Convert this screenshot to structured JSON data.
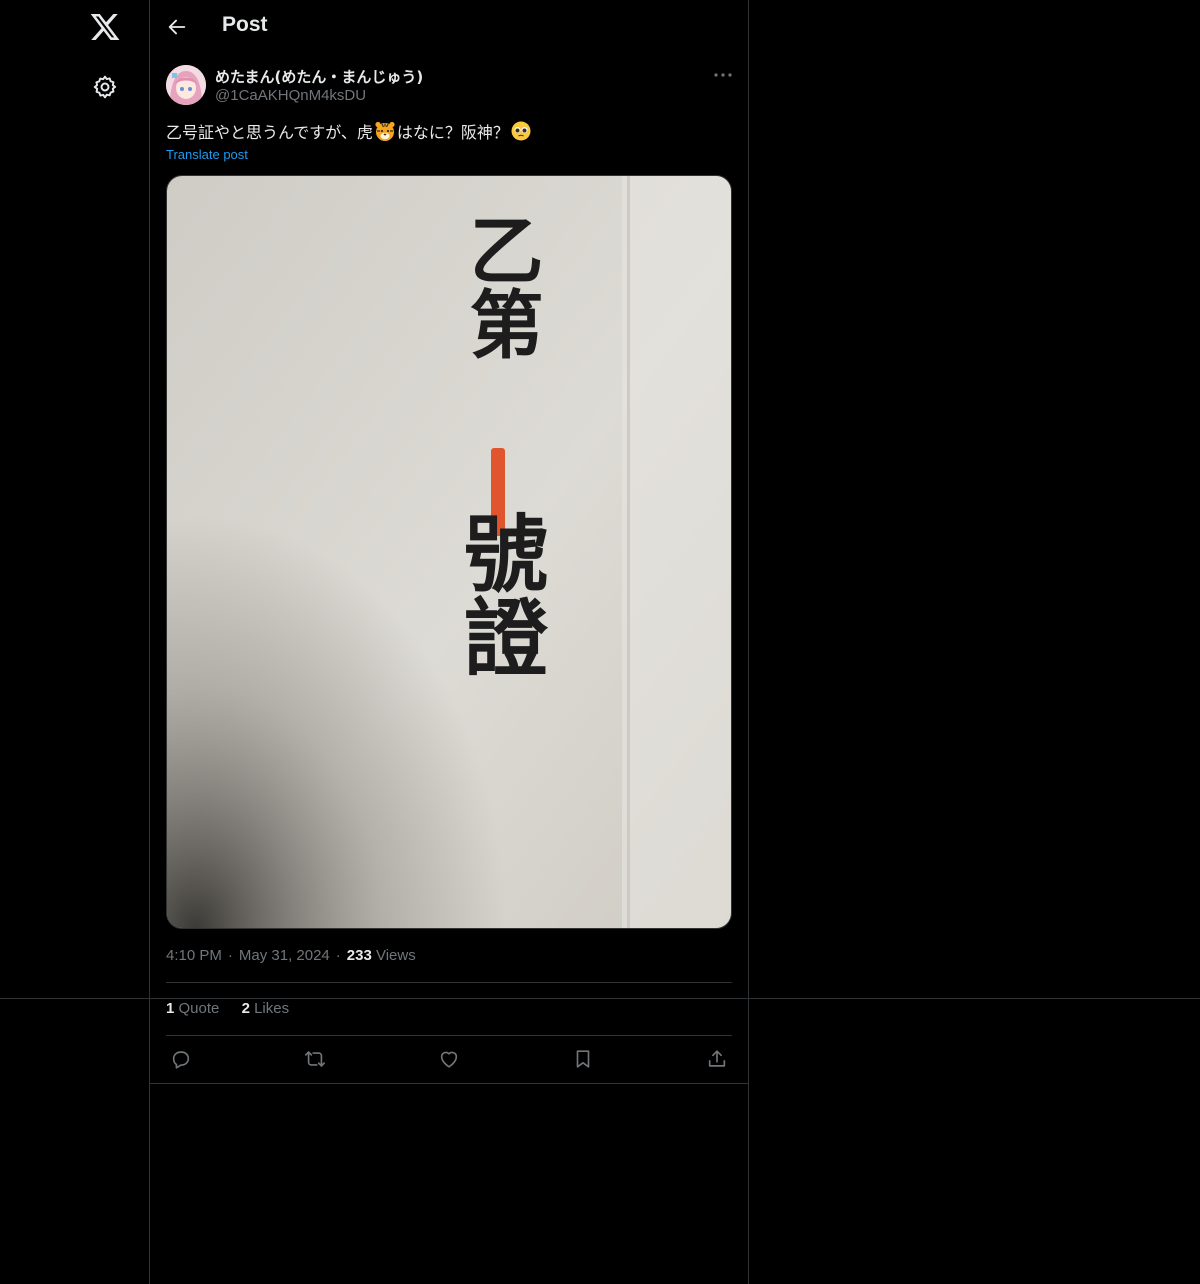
{
  "header": {
    "title": "Post"
  },
  "author": {
    "display_name": "めたまん(めたん・まんじゅう)",
    "handle": "@1CaAKHQnM4ksDU"
  },
  "post": {
    "text_before_tiger": "乙号証やと思うんですが、虎",
    "text_after_tiger": "はなに？阪神？",
    "emoji_1": "tiger-face-emoji",
    "emoji_2": "pleading-face-emoji",
    "translate_label": "Translate post",
    "image": {
      "text_top": "乙第",
      "text_bottom": "號證",
      "mark": "red-vertical-line",
      "paper_color": "#dcdad3",
      "ink_color": "#1d1d1d",
      "mark_color": "#e0552d"
    }
  },
  "meta": {
    "time": "4:10 PM",
    "date": "May 31, 2024",
    "views_count": "233",
    "views_label": "Views"
  },
  "stats": {
    "quotes_count": "1",
    "quotes_label": "Quote",
    "likes_count": "2",
    "likes_label": "Likes"
  },
  "actions": [
    "reply-icon",
    "repost-icon",
    "like-icon",
    "bookmark-icon",
    "share-icon"
  ],
  "colors": {
    "background": "#000000",
    "text": "#e7e9ea",
    "muted": "#71767b",
    "link": "#1d9bf0",
    "border": "#2f3336"
  }
}
